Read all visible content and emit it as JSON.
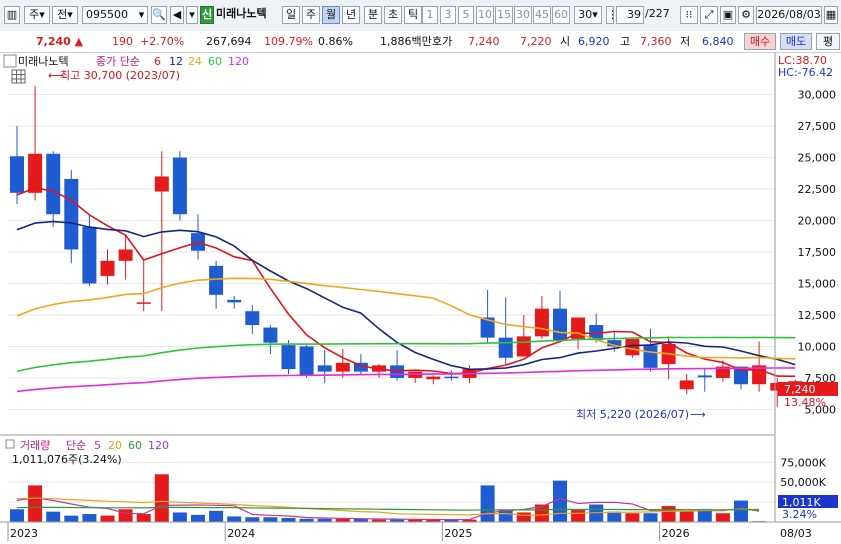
{
  "toolbar": {
    "market": "주",
    "period_main": "전",
    "code": "095500",
    "credit_badge": "신",
    "stock_name": "미래나노텍",
    "period_tabs": [
      "일",
      "주",
      "월",
      "년",
      "분",
      "초",
      "틱"
    ],
    "selected_tab": "월",
    "interval_buttons": [
      "1",
      "3",
      "5",
      "10",
      "15",
      "30",
      "45",
      "60"
    ],
    "interval_value": "30",
    "page_counter": "39",
    "page_total": "/227",
    "date": "2026/08/03"
  },
  "quote": {
    "price": "7,240",
    "change": "190",
    "change_pct": "+2.70%",
    "volume": "267,694",
    "volume_ratio": "109.79%",
    "turnover": "0.86%",
    "amount": "1,886백만",
    "hoga_label": "호가",
    "ask": "7,240",
    "bid": "7,220",
    "open_label": "시",
    "open": "6,920",
    "high_label": "고",
    "high": "7,360",
    "low_label": "저",
    "low": "6,840",
    "buy_label": "매수",
    "sell_label": "매도",
    "eval_label": "평"
  },
  "legend": {
    "name": "미래나노텍",
    "price_label": "종가 단순",
    "ma": [
      "6",
      "12",
      "24",
      "60",
      "120"
    ],
    "max_label": "최고 30,700 (2023/07)",
    "min_label": "최저 5,220 (2026/07)",
    "lc": "LC:38.70",
    "hc": "HC:-76.42",
    "last_price": "7,240",
    "last_pct": "13.48%"
  },
  "volume_legend": {
    "name": "거래량",
    "ma_label": "단순",
    "ma": [
      "5",
      "20",
      "60",
      "120"
    ],
    "last_value": "1,011,076주(3.24%)",
    "last_box": "1,011K",
    "last_pct": "3.24%"
  },
  "x_labels": [
    "2023",
    "2024",
    "2025",
    "2026"
  ],
  "x_corner": "08/03",
  "colors": {
    "up": "#e41a1c",
    "down": "#1f5bd1",
    "ma6": "#e4141b",
    "ma12": "#14287a",
    "ma24": "#f0a81a",
    "ma60": "#2cc63a",
    "ma120": "#e52be0",
    "vol_ma5": "#c0399a",
    "vol_ma20": "#e3a51d",
    "vol_ma60": "#2a9a35"
  },
  "chart_data": {
    "type": "candlestick",
    "periods": [
      "2023/01",
      "2023/02",
      "2023/03",
      "2023/04",
      "2023/05",
      "2023/06",
      "2023/07",
      "2023/08",
      "2023/09",
      "2023/10",
      "2023/11",
      "2023/12",
      "2024/01",
      "2024/02",
      "2024/03",
      "2024/04",
      "2024/05",
      "2024/06",
      "2024/07",
      "2024/08",
      "2024/09",
      "2024/10",
      "2024/11",
      "2024/12",
      "2025/01",
      "2025/02",
      "2025/03",
      "2025/04",
      "2025/05",
      "2025/06",
      "2025/07",
      "2025/08",
      "2025/09",
      "2025/10",
      "2025/11",
      "2025/12",
      "2026/01",
      "2026/02",
      "2026/03",
      "2026/04",
      "2026/05",
      "2026/06",
      "2026/07",
      "2026/08"
    ],
    "open": [
      25100,
      22200,
      25300,
      23300,
      19500,
      15600,
      16800,
      13500,
      22300,
      25000,
      19000,
      16400,
      13700,
      12800,
      11500,
      10100,
      10000,
      8500,
      8000,
      8700,
      8000,
      8500,
      7500,
      7400,
      7600,
      7500,
      12300,
      10700,
      9200,
      10800,
      13000,
      10600,
      11700,
      10500,
      9300,
      10100,
      8600,
      6600,
      7700,
      7500,
      8400,
      7000,
      6500,
      7050
    ],
    "close": [
      22200,
      25300,
      20500,
      17700,
      15000,
      16800,
      17700,
      13500,
      23500,
      20500,
      17600,
      14100,
      13500,
      11700,
      10300,
      8200,
      7700,
      8000,
      8700,
      8000,
      8500,
      7500,
      8000,
      7600,
      7500,
      8200,
      10700,
      9100,
      10800,
      13000,
      10500,
      12300,
      10500,
      10000,
      10600,
      8300,
      10200,
      7300,
      7550,
      8400,
      7000,
      8500,
      7100,
      7240
    ],
    "high": [
      27500,
      30700,
      25500,
      24000,
      20500,
      17700,
      18800,
      16800,
      25500,
      25500,
      20500,
      16800,
      14000,
      13300,
      11700,
      10500,
      10100,
      9700,
      9800,
      9400,
      8600,
      9700,
      8000,
      7700,
      8100,
      8500,
      14500,
      13900,
      12500,
      14000,
      14400,
      12000,
      12600,
      11100,
      10600,
      11400,
      10800,
      7800,
      8300,
      8900,
      8400,
      10400,
      7500,
      7360
    ],
    "low": [
      21300,
      21600,
      19500,
      16600,
      14800,
      14900,
      15300,
      12800,
      12800,
      20000,
      16900,
      13000,
      13000,
      11000,
      9400,
      7800,
      7500,
      7100,
      7500,
      7700,
      7500,
      7300,
      7100,
      7000,
      7300,
      7100,
      10300,
      8600,
      9200,
      10600,
      10400,
      9800,
      10300,
      9600,
      9100,
      8000,
      7400,
      6200,
      6400,
      7200,
      6600,
      6400,
      5220,
      6840
    ],
    "ma6": null,
    "volume_k": [
      16000,
      46000,
      13000,
      8000,
      10000,
      8000,
      16000,
      10000,
      60000,
      12000,
      9000,
      14000,
      7000,
      6000,
      6000,
      5000,
      4000,
      4000,
      4000,
      4000,
      3000,
      3000,
      3000,
      3000,
      3000,
      3000,
      46000,
      15000,
      12000,
      22000,
      52000,
      15000,
      22000,
      13000,
      11000,
      11000,
      20000,
      13000,
      16000,
      11000,
      27000,
      1011
    ],
    "ylim": [
      4000,
      31000
    ],
    "vol_ylim": [
      0,
      88000
    ]
  }
}
